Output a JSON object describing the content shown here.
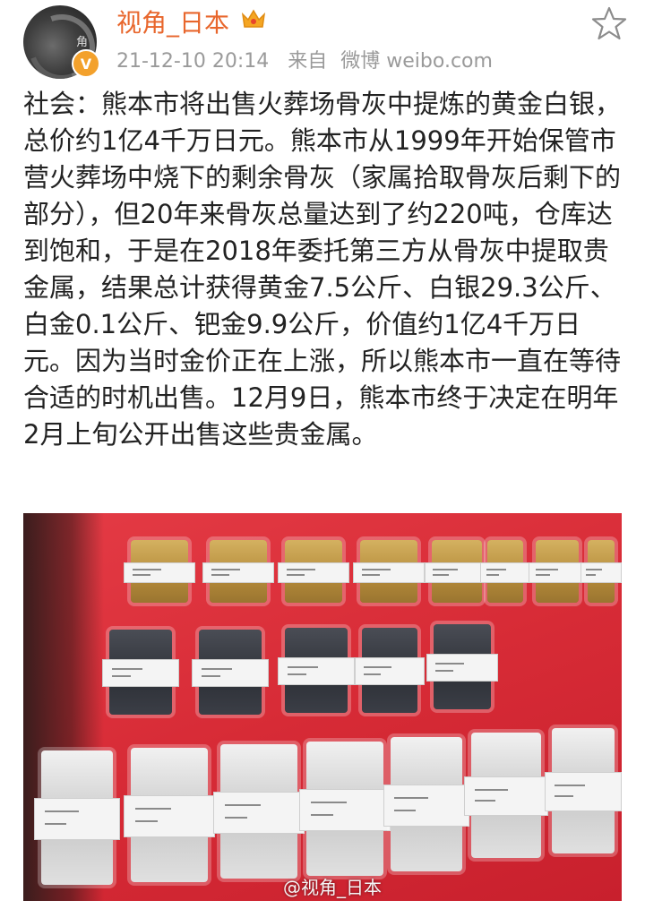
{
  "post": {
    "username": "视角_日本",
    "timestamp": "21-12-10 20:14",
    "source_prefix": "来自",
    "source": "微博 weibo.com",
    "avatar_mark": "角",
    "verified_badge": "V",
    "text": "社会：熊本市将出售火葬场骨灰中提炼的黄金白银，总价约1亿4千万日元。熊本市从1999年开始保管市营火葬场中烧下的剩余骨灰（家属拾取骨灰后剩下的部分），但20年来骨灰总量达到了约220吨，仓库达到饱和，于是在2018年委托第三方从骨灰中提取贵金属，结果总计获得黄金7.5公斤、白银29.3公斤、白金0.1公斤、钯金9.9公斤，价值约1亿4千万日元。因为当时金价正在上涨，所以熊本市一直在等待合适的时机出售。12月9日，熊本市终于决定在明年2月上旬公开出售这些贵金属。",
    "photo_watermark": "@视角_日本"
  },
  "icons": {
    "favorite": "star-outline-icon",
    "vip": "crown-icon",
    "verified": "verified-v-icon"
  },
  "colors": {
    "username": "#e8662c",
    "meta": "#9a9a9a",
    "badge": "#f3a12c",
    "photo_bg": "#d72b36"
  }
}
